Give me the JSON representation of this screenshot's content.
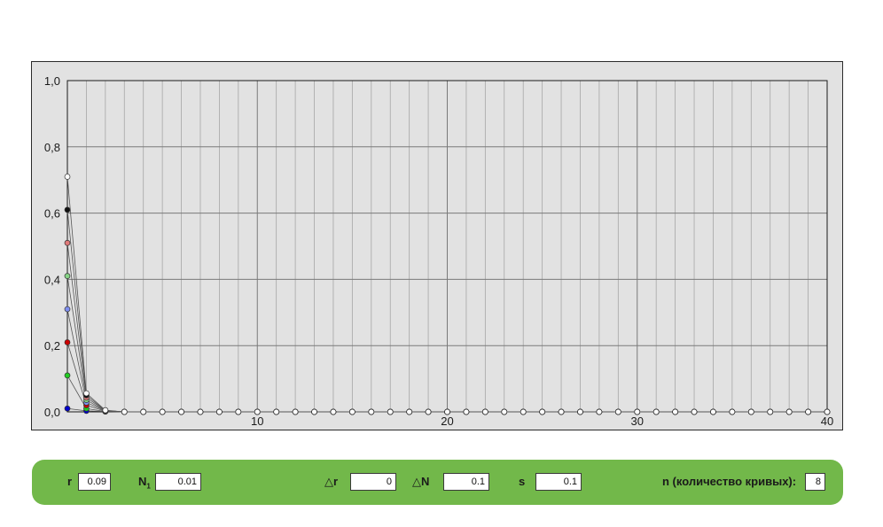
{
  "chart_data": {
    "type": "line",
    "xlabel": "",
    "ylabel": "",
    "xlim": [
      0,
      40
    ],
    "ylim": [
      0,
      1
    ],
    "x_ticks": [
      10,
      20,
      30,
      40
    ],
    "x_tick_labels": [
      "10",
      "20",
      "30",
      "40"
    ],
    "y_ticks": [
      0,
      0.2,
      0.4,
      0.6,
      0.8,
      1.0
    ],
    "y_tick_labels": [
      "0,0",
      "0,2",
      "0,4",
      "0,6",
      "0,8",
      "1,0"
    ],
    "grid": true,
    "x": [
      0,
      1,
      2,
      3,
      4,
      5,
      6,
      7,
      8,
      9,
      10,
      11,
      12,
      13,
      14,
      15,
      16,
      17,
      18,
      19,
      20,
      21,
      22,
      23,
      24,
      25,
      26,
      27,
      28,
      29,
      30,
      31,
      32,
      33,
      34,
      35,
      36,
      37,
      38,
      39,
      40
    ],
    "series": [
      {
        "color": "#0000cc",
        "values": [
          0.01,
          0.003,
          0.001,
          0,
          0,
          0,
          0,
          0,
          0,
          0,
          0,
          0,
          0,
          0,
          0,
          0,
          0,
          0,
          0,
          0,
          0,
          0,
          0,
          0,
          0,
          0,
          0,
          0,
          0,
          0,
          0,
          0,
          0,
          0,
          0,
          0,
          0,
          0,
          0,
          0,
          0
        ]
      },
      {
        "color": "#22cc22",
        "values": [
          0.11,
          0.01,
          0.001,
          0,
          0,
          0,
          0,
          0,
          0,
          0,
          0,
          0,
          0,
          0,
          0,
          0,
          0,
          0,
          0,
          0,
          0,
          0,
          0,
          0,
          0,
          0,
          0,
          0,
          0,
          0,
          0,
          0,
          0,
          0,
          0,
          0,
          0,
          0,
          0,
          0,
          0
        ]
      },
      {
        "color": "#cc0000",
        "values": [
          0.21,
          0.02,
          0.002,
          0,
          0,
          0,
          0,
          0,
          0,
          0,
          0,
          0,
          0,
          0,
          0,
          0,
          0,
          0,
          0,
          0,
          0,
          0,
          0,
          0,
          0,
          0,
          0,
          0,
          0,
          0,
          0,
          0,
          0,
          0,
          0,
          0,
          0,
          0,
          0,
          0,
          0
        ]
      },
      {
        "color": "#7f8ff0",
        "values": [
          0.31,
          0.028,
          0.003,
          0,
          0,
          0,
          0,
          0,
          0,
          0,
          0,
          0,
          0,
          0,
          0,
          0,
          0,
          0,
          0,
          0,
          0,
          0,
          0,
          0,
          0,
          0,
          0,
          0,
          0,
          0,
          0,
          0,
          0,
          0,
          0,
          0,
          0,
          0,
          0,
          0,
          0
        ]
      },
      {
        "color": "#86d486",
        "values": [
          0.41,
          0.036,
          0.003,
          0,
          0,
          0,
          0,
          0,
          0,
          0,
          0,
          0,
          0,
          0,
          0,
          0,
          0,
          0,
          0,
          0,
          0,
          0,
          0,
          0,
          0,
          0,
          0,
          0,
          0,
          0,
          0,
          0,
          0,
          0,
          0,
          0,
          0,
          0,
          0,
          0,
          0
        ]
      },
      {
        "color": "#e07a7a",
        "values": [
          0.51,
          0.043,
          0.004,
          0,
          0,
          0,
          0,
          0,
          0,
          0,
          0,
          0,
          0,
          0,
          0,
          0,
          0,
          0,
          0,
          0,
          0,
          0,
          0,
          0,
          0,
          0,
          0,
          0,
          0,
          0,
          0,
          0,
          0,
          0,
          0,
          0,
          0,
          0,
          0,
          0,
          0
        ]
      },
      {
        "color": "#111111",
        "values": [
          0.61,
          0.05,
          0.004,
          0,
          0,
          0,
          0,
          0,
          0,
          0,
          0,
          0,
          0,
          0,
          0,
          0,
          0,
          0,
          0,
          0,
          0,
          0,
          0,
          0,
          0,
          0,
          0,
          0,
          0,
          0,
          0,
          0,
          0,
          0,
          0,
          0,
          0,
          0,
          0,
          0,
          0
        ]
      },
      {
        "color": "#ffffff",
        "values": [
          0.71,
          0.056,
          0.005,
          0,
          0,
          0,
          0,
          0,
          0,
          0,
          0,
          0,
          0,
          0,
          0,
          0,
          0,
          0,
          0,
          0,
          0,
          0,
          0,
          0,
          0,
          0,
          0,
          0,
          0,
          0,
          0,
          0,
          0,
          0,
          0,
          0,
          0,
          0,
          0,
          0,
          0
        ]
      }
    ]
  },
  "controls": {
    "r_label": "r",
    "r_value": "0.09",
    "n1_label": "N",
    "n1_sub": "1",
    "n1_value": "0.01",
    "dr_symbol": "△",
    "dr_label": "r",
    "dr_value": "0",
    "dn_symbol": "△",
    "dn_label": "N",
    "dn_value": "0.1",
    "s_label": "s",
    "s_value": "0.1",
    "n_label": "n (количество кривых):",
    "n_value": "8"
  },
  "colors": {
    "panel": "#72b84a",
    "plot_background": "#e2e2e2",
    "grid_major": "#7a7a7a",
    "grid_minor": "#a6a6a6"
  }
}
